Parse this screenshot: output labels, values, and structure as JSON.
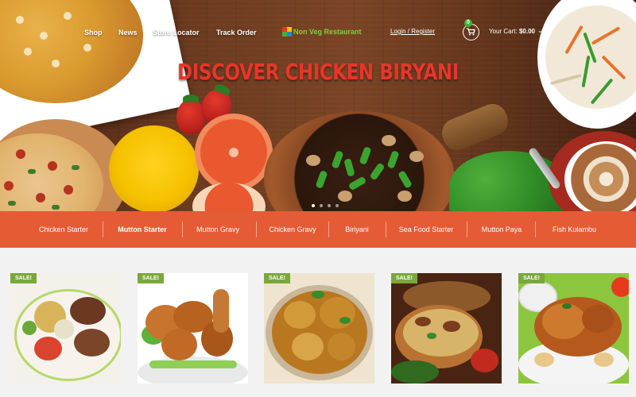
{
  "brand": {
    "name": "Non Veg Restaurant",
    "logo_icon": "logo-icon"
  },
  "nav": {
    "items": [
      {
        "label": "Shop"
      },
      {
        "label": "News"
      },
      {
        "label": "Store Locator"
      },
      {
        "label": "Track Order"
      }
    ],
    "login_label": "Login / Register",
    "cart": {
      "count": "0",
      "label": "Your Cart:",
      "amount": "$0.00",
      "icon": "cart-icon"
    }
  },
  "hero": {
    "headline": "DISCOVER CHICKEN BIRYANI",
    "slides": 4,
    "active_slide": 1
  },
  "categories": [
    {
      "label": "Chicken Starter"
    },
    {
      "label": "Mutton Starter",
      "active": true
    },
    {
      "label": "Mutton Gravy"
    },
    {
      "label": "Chicken Gravy"
    },
    {
      "label": "Biriyani"
    },
    {
      "label": "Sea Food Starter"
    },
    {
      "label": "Mutton Paya"
    },
    {
      "label": "Fish Kulambu"
    }
  ],
  "products": [
    {
      "badge": "SALE!"
    },
    {
      "badge": "SALE!"
    },
    {
      "badge": "SALE!"
    },
    {
      "badge": "SALE!"
    },
    {
      "badge": "SALE!"
    }
  ],
  "colors": {
    "accent": "#e55b36",
    "headline": "#e8352a",
    "sale_badge": "#7aa83a",
    "logo_text": "#7dd23b",
    "cart_badge": "#3fb33a"
  }
}
